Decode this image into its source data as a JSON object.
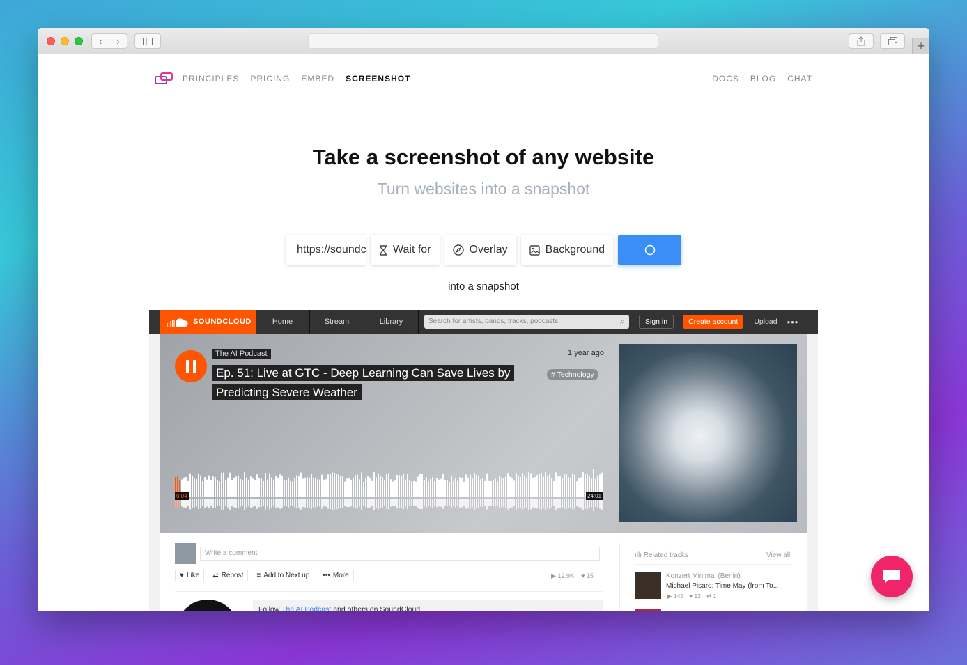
{
  "nav": {
    "left": [
      "PRINCIPLES",
      "PRICING",
      "EMBED",
      "SCREENSHOT"
    ],
    "active": "SCREENSHOT",
    "right": [
      "DOCS",
      "BLOG",
      "CHAT"
    ]
  },
  "hero": {
    "title": "Take a screenshot of any website",
    "subtitle": "Turn websites into a snapshot"
  },
  "controls": {
    "url_value": "https://soundcloud.com",
    "wait_for": "Wait for",
    "overlay": "Overlay",
    "background": "Background"
  },
  "caption": "into a snapshot",
  "preview": {
    "brand": "SOUNDCLOUD",
    "nav": [
      "Home",
      "Stream",
      "Library"
    ],
    "search_placeholder": "Search for artists, bands, tracks, podcasts",
    "sign_in": "Sign in",
    "create_account": "Create account",
    "upload": "Upload",
    "more_dots": "•••",
    "artist": "The AI Podcast",
    "track_title": "Ep. 51: Live at GTC - Deep Learning Can Save Lives by Predicting Severe Weather",
    "posted": "1 year ago",
    "tag": "# Technology",
    "time_elapsed": "0:04",
    "time_total": "24:01",
    "comment_placeholder": "Write a comment",
    "actions": {
      "like": "Like",
      "repost": "Repost",
      "next_up": "Add to Next up",
      "more": "More"
    },
    "plays": "12.9K",
    "likes": "15",
    "follow_prefix": "Follow ",
    "follow_link": "The AI Podcast",
    "follow_suffix": " and others on SoundCloud.",
    "related_label": "Related tracks",
    "view_all": "View all",
    "related": {
      "user": "Konzert Minimal (Berlin)",
      "title": "Michael Pisaro: Time May (from To...",
      "plays": "145",
      "likes": "12",
      "reposts": "1"
    }
  },
  "colors": {
    "accent": "#3b8ef5",
    "soundcloud": "#ff5500",
    "chat": "#f0246a"
  }
}
